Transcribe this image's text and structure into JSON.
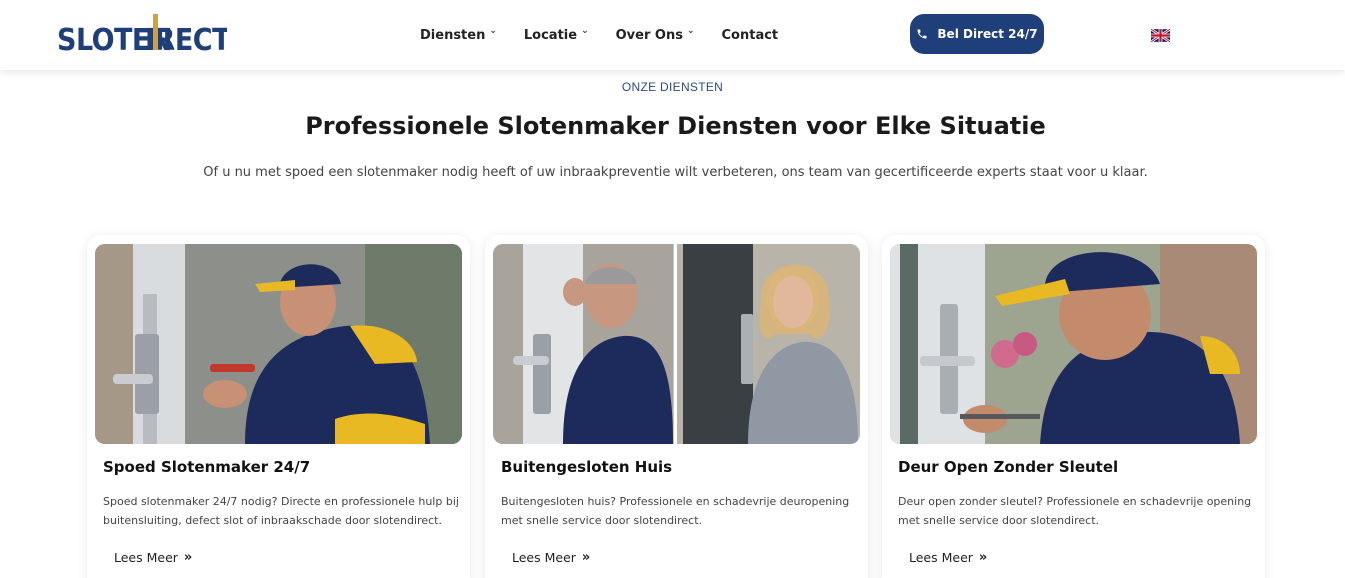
{
  "header": {
    "logo": {
      "part1": "SLOTEN",
      "part2": "DIRECT"
    },
    "nav": [
      {
        "label": "Diensten",
        "has_dropdown": true
      },
      {
        "label": "Locatie",
        "has_dropdown": true
      },
      {
        "label": "Over Ons",
        "has_dropdown": true
      },
      {
        "label": "Contact",
        "has_dropdown": false
      }
    ],
    "cta_label": "Bel Direct 24/7",
    "language_flag": "uk-flag-icon"
  },
  "intro": {
    "eyebrow": "ONZE DIENSTEN",
    "title": "Professionele Slotenmaker Diensten voor Elke Situatie",
    "subtitle": "Of u nu met spoed een slotenmaker nodig heeft of uw inbraakpreventie wilt verbeteren, ons team van gecertificeerde experts staat voor u klaar."
  },
  "cards": [
    {
      "title": "Spoed Slotenmaker 24/7",
      "text": "Spoed slotenmaker 24/7 nodig? Directe en professionele hulp bij buitensluiting, defect slot of inbraakschade door slotendirect.",
      "link": "Lees Meer"
    },
    {
      "title": "Buitengesloten Huis",
      "text": "Buitengesloten huis? Professionele en schadevrije deuropening met snelle service door slotendirect.",
      "link": "Lees Meer"
    },
    {
      "title": "Deur Open Zonder Sleutel",
      "text": "Deur open zonder sleutel? Professionele en schadevrije opening met snelle service door slotendirect.",
      "link": "Lees Meer"
    }
  ],
  "colors": {
    "brand_blue": "#1f3f7a",
    "brand_gold": "#c9a24a",
    "accent_yellow": "#e8b923"
  }
}
